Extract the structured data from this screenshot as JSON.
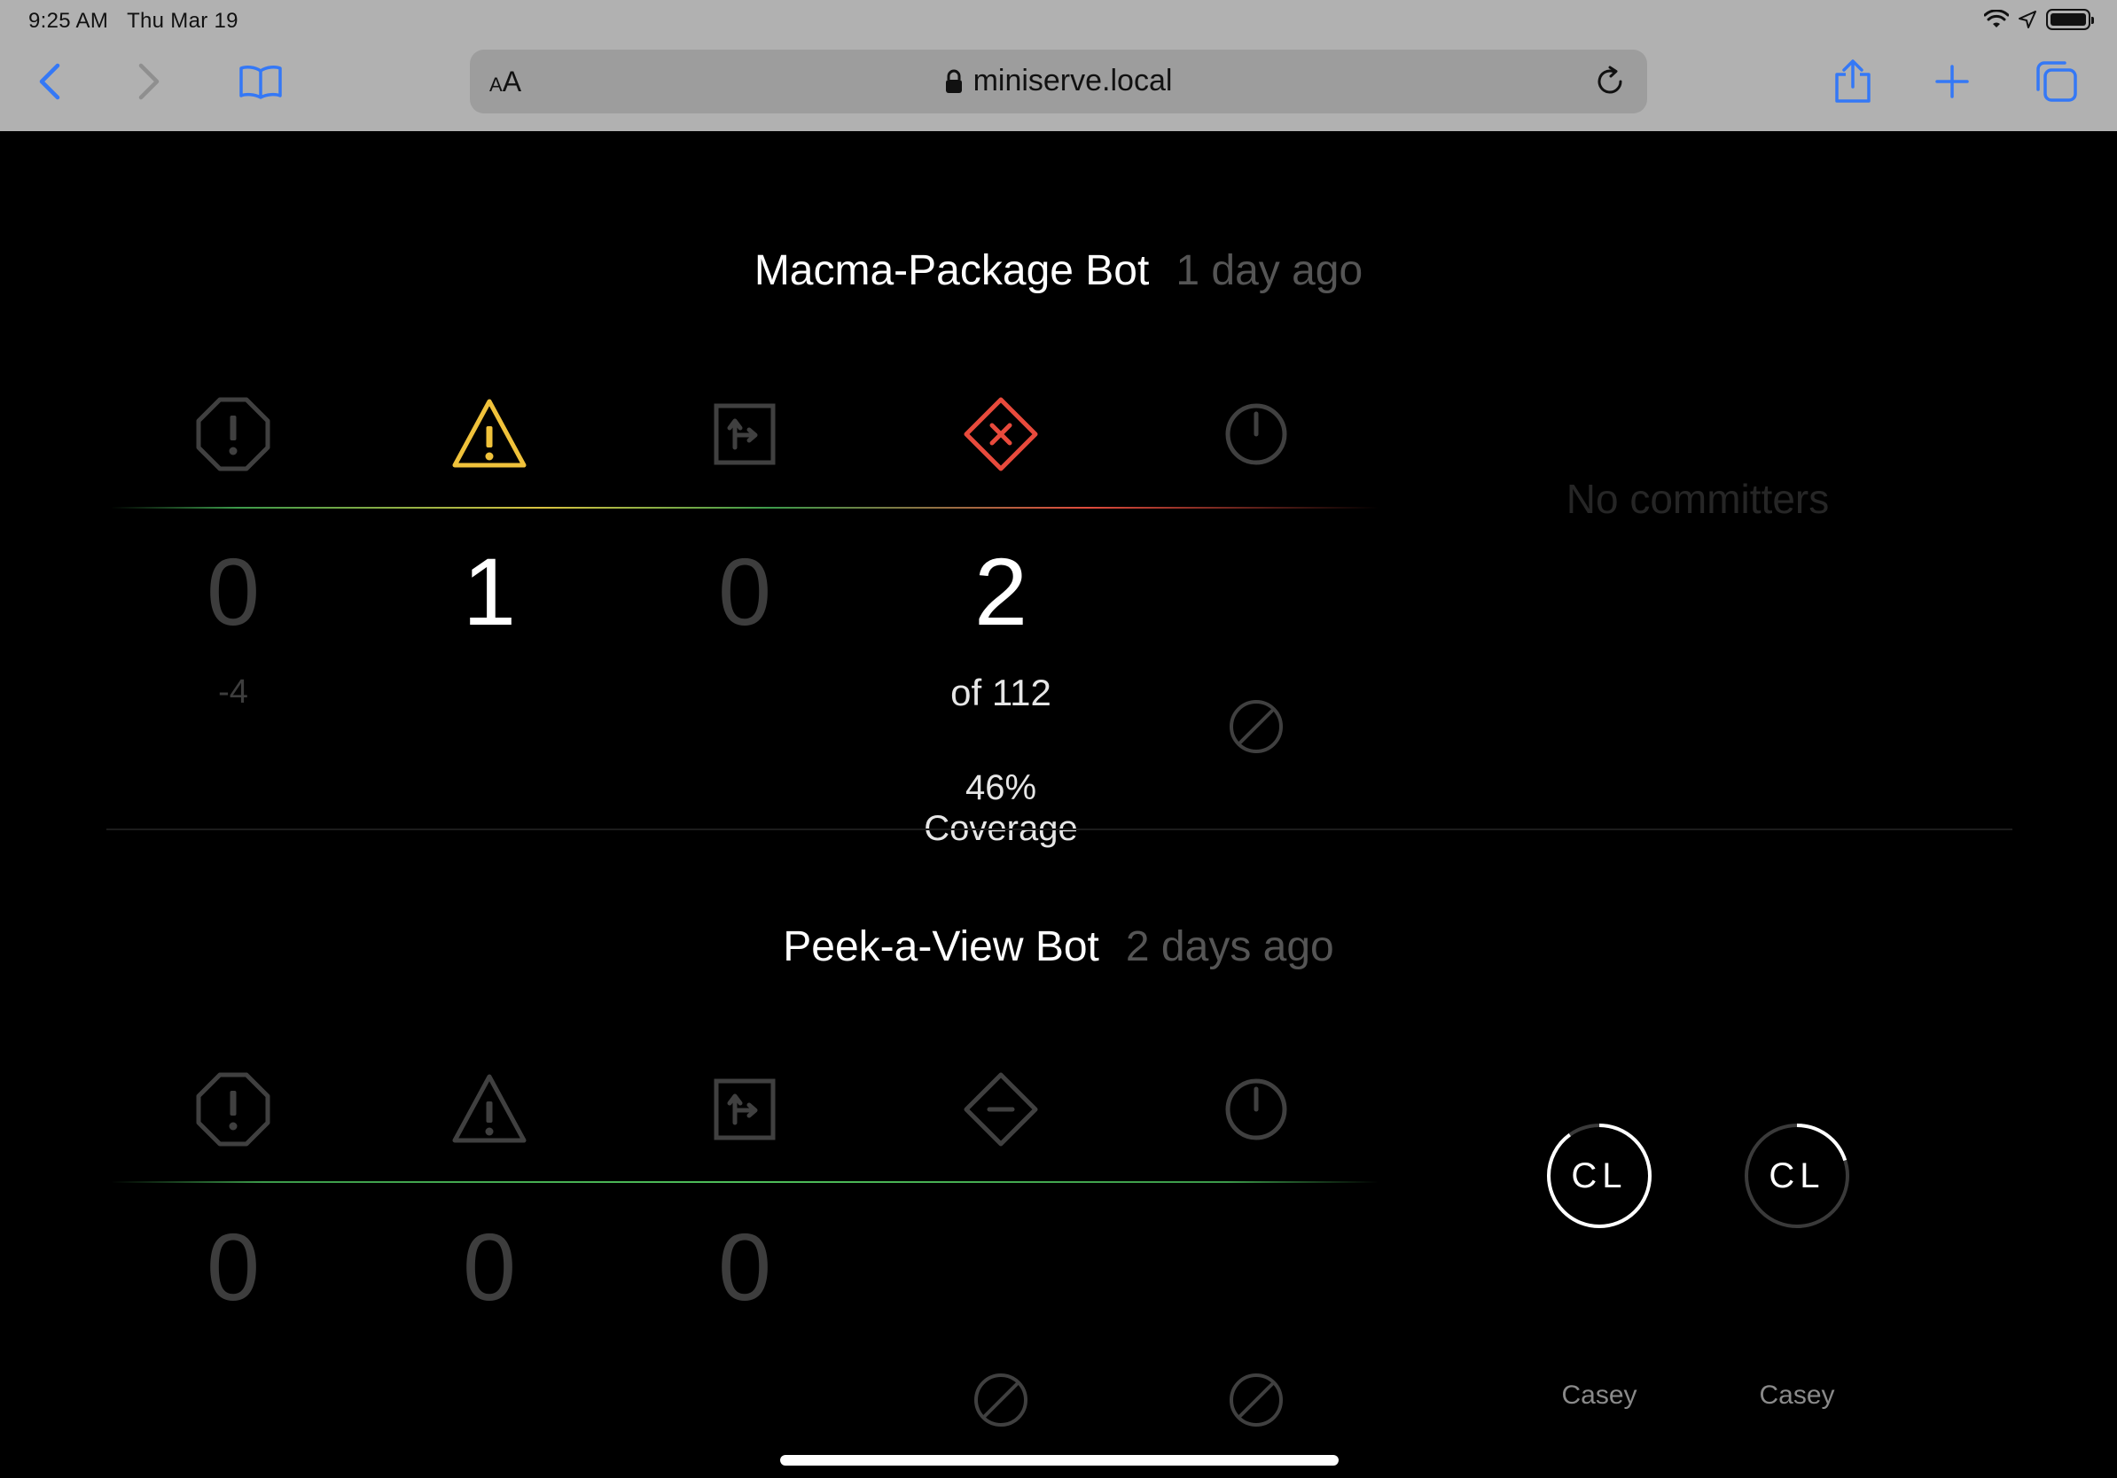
{
  "status_bar": {
    "time": "9:25 AM",
    "date": "Thu Mar 19"
  },
  "toolbar": {
    "aa_label_small": "A",
    "aa_label_large": "A",
    "url": "miniserve.local",
    "accent_color": "#3478f6"
  },
  "bots": [
    {
      "name": "Macma-Package Bot",
      "ago": "1 day ago",
      "icons": [
        "error-octagon-icon",
        "warning-triangle-icon",
        "analyzer-square-icon",
        "test-failure-diamond-icon",
        "clock-icon"
      ],
      "values": [
        "0",
        "1",
        "0",
        "2"
      ],
      "subtexts": [
        "-4",
        "",
        "",
        "of 112"
      ],
      "coverage_value": "46%",
      "coverage_label": "Coverage",
      "committers_text": "No committers",
      "colors": {
        "warning": "#f0c23b",
        "failure": "#e84a3c"
      }
    },
    {
      "name": "Peek-a-View Bot",
      "ago": "2 days ago",
      "icons": [
        "error-octagon-icon",
        "warning-triangle-icon",
        "analyzer-square-icon",
        "test-diamond-icon",
        "clock-icon"
      ],
      "values": [
        "0",
        "0",
        "0"
      ],
      "committers": [
        {
          "initials": "CL",
          "name": "Casey",
          "ring_progress": 0.9
        },
        {
          "initials": "CL",
          "name": "Casey",
          "ring_progress": 0.2
        }
      ]
    }
  ]
}
